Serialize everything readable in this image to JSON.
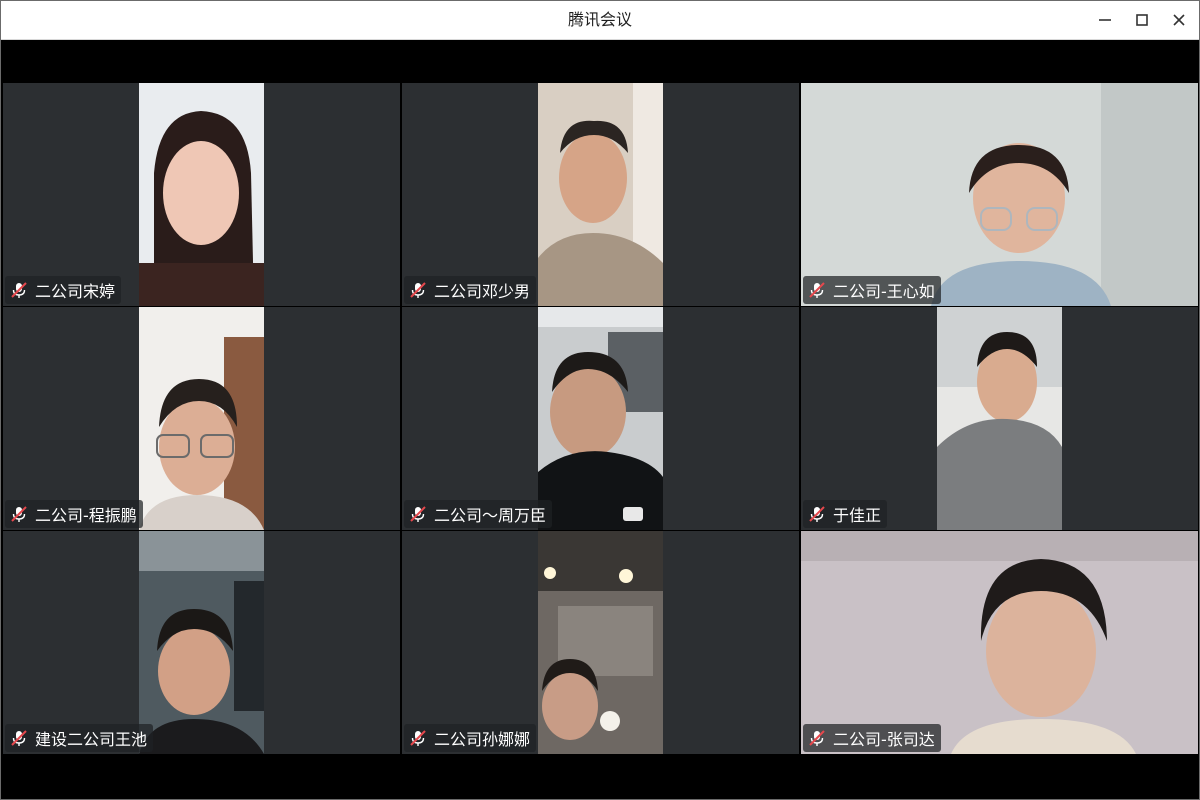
{
  "window": {
    "title": "腾讯会议"
  },
  "colors": {
    "tile_background": "#2c2f32",
    "muted_mic": "#e5484d",
    "name_tag_text": "#ffffff"
  },
  "participants": [
    {
      "name": "二公司宋婷",
      "mic": "muted",
      "video": "portrait"
    },
    {
      "name": "二公司邓少男",
      "mic": "muted",
      "video": "portrait"
    },
    {
      "name": "二公司-王心如",
      "mic": "muted",
      "video": "full"
    },
    {
      "name": "二公司-程振鹏",
      "mic": "muted",
      "video": "portrait"
    },
    {
      "name": "二公司～周万臣",
      "mic": "muted",
      "video": "portrait"
    },
    {
      "name": "于佳正",
      "mic": "muted",
      "video": "portrait"
    },
    {
      "name": "建设二公司王池",
      "mic": "muted",
      "video": "portrait"
    },
    {
      "name": "二公司孙娜娜",
      "mic": "muted",
      "video": "portrait"
    },
    {
      "name": "二公司-张司达",
      "mic": "muted",
      "video": "full"
    }
  ]
}
